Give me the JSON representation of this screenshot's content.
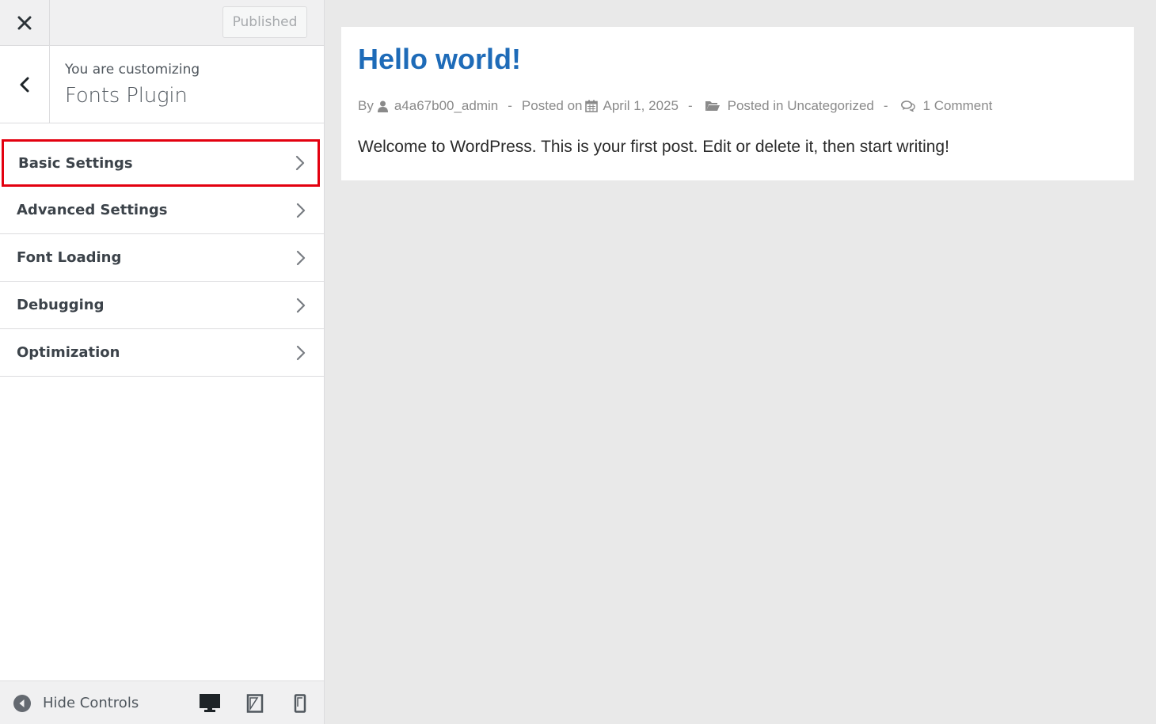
{
  "sidebar": {
    "close_label": "×",
    "publish_label": "Published",
    "customizing_label": "You are customizing",
    "customizing_title": "Fonts Plugin",
    "items": [
      {
        "label": "Basic Settings",
        "highlighted": true
      },
      {
        "label": "Advanced Settings"
      },
      {
        "label": "Font Loading"
      },
      {
        "label": "Debugging"
      },
      {
        "label": "Optimization"
      }
    ],
    "footer": {
      "hide_controls_label": "Hide Controls",
      "devices": [
        "desktop-icon",
        "tablet-icon",
        "mobile-icon"
      ]
    }
  },
  "preview": {
    "title": "Hello world!",
    "meta": {
      "by_label": "By",
      "author": "a4a67b00_admin",
      "posted_on_label": "Posted on",
      "date": "April 1, 2025",
      "posted_in_label": "Posted in",
      "category": "Uncategorized",
      "comments": "1 Comment",
      "separator": "-"
    },
    "body": "Welcome to WordPress. This is your first post. Edit or delete it, then start writing!"
  },
  "colors": {
    "title_blue": "#1e6bb8",
    "highlight_red": "#e3000f",
    "preview_bg": "#e9e9e9"
  }
}
